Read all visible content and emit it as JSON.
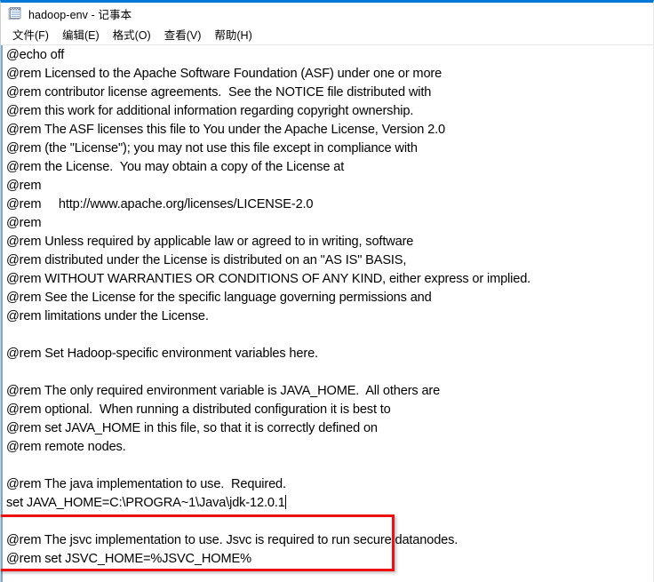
{
  "window": {
    "title": "hadoop-env - 记事本",
    "icon": "notepad-icon",
    "accent_color": "#0078d7"
  },
  "menubar": {
    "items": [
      {
        "label": "文件(F)",
        "name": "menu-file"
      },
      {
        "label": "编辑(E)",
        "name": "menu-edit"
      },
      {
        "label": "格式(O)",
        "name": "menu-format"
      },
      {
        "label": "查看(V)",
        "name": "menu-view"
      },
      {
        "label": "帮助(H)",
        "name": "menu-help"
      }
    ]
  },
  "editor": {
    "caret_visible": true,
    "lines": [
      "@echo off",
      "@rem Licensed to the Apache Software Foundation (ASF) under one or more",
      "@rem contributor license agreements.  See the NOTICE file distributed with",
      "@rem this work for additional information regarding copyright ownership.",
      "@rem The ASF licenses this file to You under the Apache License, Version 2.0",
      "@rem (the \"License\"); you may not use this file except in compliance with",
      "@rem the License.  You may obtain a copy of the License at",
      "@rem",
      "@rem     http://www.apache.org/licenses/LICENSE-2.0",
      "@rem",
      "@rem Unless required by applicable law or agreed to in writing, software",
      "@rem distributed under the License is distributed on an \"AS IS\" BASIS,",
      "@rem WITHOUT WARRANTIES OR CONDITIONS OF ANY KIND, either express or implied.",
      "@rem See the License for the specific language governing permissions and",
      "@rem limitations under the License.",
      "",
      "@rem Set Hadoop-specific environment variables here.",
      "",
      "@rem The only required environment variable is JAVA_HOME.  All others are",
      "@rem optional.  When running a distributed configuration it is best to",
      "@rem set JAVA_HOME in this file, so that it is correctly defined on",
      "@rem remote nodes.",
      "",
      "@rem The java implementation to use.  Required.",
      "set JAVA_HOME=C:\\PROGRA~1\\Java\\jdk-12.0.1",
      "",
      "@rem The jsvc implementation to use. Jsvc is required to run secure datanodes.",
      "@rem set JSVC_HOME=%JSVC_HOME%"
    ],
    "caret_line_index": 24
  },
  "annotation": {
    "type": "red-rectangle-highlight",
    "color": "#ee1111",
    "highlighted_lines": [
      "@rem The java implementation to use.  Required.",
      "set JAVA_HOME=C:\\PROGRA~1\\Java\\jdk-12.0.1"
    ]
  }
}
